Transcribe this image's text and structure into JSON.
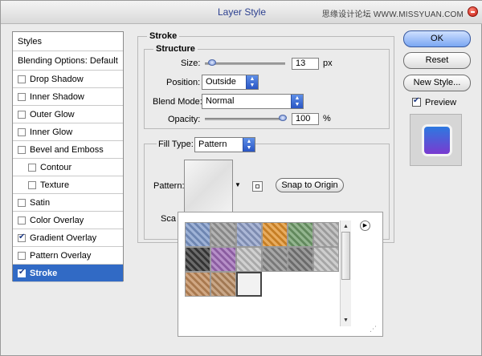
{
  "window": {
    "title": "Layer Style",
    "watermark": "思缘设计论坛 WWW.MISSYUAN.COM"
  },
  "styles_panel": {
    "header": "Styles",
    "blending": "Blending Options: Default",
    "items": [
      {
        "label": "Drop Shadow",
        "checked": false
      },
      {
        "label": "Inner Shadow",
        "checked": false
      },
      {
        "label": "Outer Glow",
        "checked": false
      },
      {
        "label": "Inner Glow",
        "checked": false
      },
      {
        "label": "Bevel and Emboss",
        "checked": false
      },
      {
        "label": "Contour",
        "checked": false
      },
      {
        "label": "Texture",
        "checked": false
      },
      {
        "label": "Satin",
        "checked": false
      },
      {
        "label": "Color Overlay",
        "checked": false
      },
      {
        "label": "Gradient Overlay",
        "checked": true
      },
      {
        "label": "Pattern Overlay",
        "checked": false
      },
      {
        "label": "Stroke",
        "checked": true
      }
    ]
  },
  "stroke": {
    "title": "Stroke",
    "structure": {
      "title": "Structure",
      "size_label": "Size:",
      "size_value": "13",
      "size_unit": "px",
      "position_label": "Position:",
      "position_value": "Outside",
      "blend_label": "Blend Mode:",
      "blend_value": "Normal",
      "opacity_label": "Opacity:",
      "opacity_value": "100",
      "opacity_unit": "%"
    },
    "fill_type_label": "Fill Type:",
    "fill_type_value": "Pattern",
    "pattern_label": "Pattern:",
    "snap_label": "Snap to Origin",
    "scale_label_partial": "Sca"
  },
  "buttons": {
    "ok": "OK",
    "reset": "Reset",
    "new_style": "New Style...",
    "preview": "Preview"
  },
  "preview_checked": true,
  "pattern_tiles": [
    [
      "#7d98c9",
      "#9a9a9a",
      "#8f9fc8",
      "#e0902a",
      "#6f9c6a",
      "#b0b0b0"
    ],
    [
      "#3a3a3a",
      "#9e6ab6",
      "#c0c0c0",
      "#8a8a8a",
      "#7a7a7a",
      "#bdbdbd"
    ],
    [
      "#c08a5a",
      "#b78a60",
      "#f2f2f2"
    ]
  ]
}
